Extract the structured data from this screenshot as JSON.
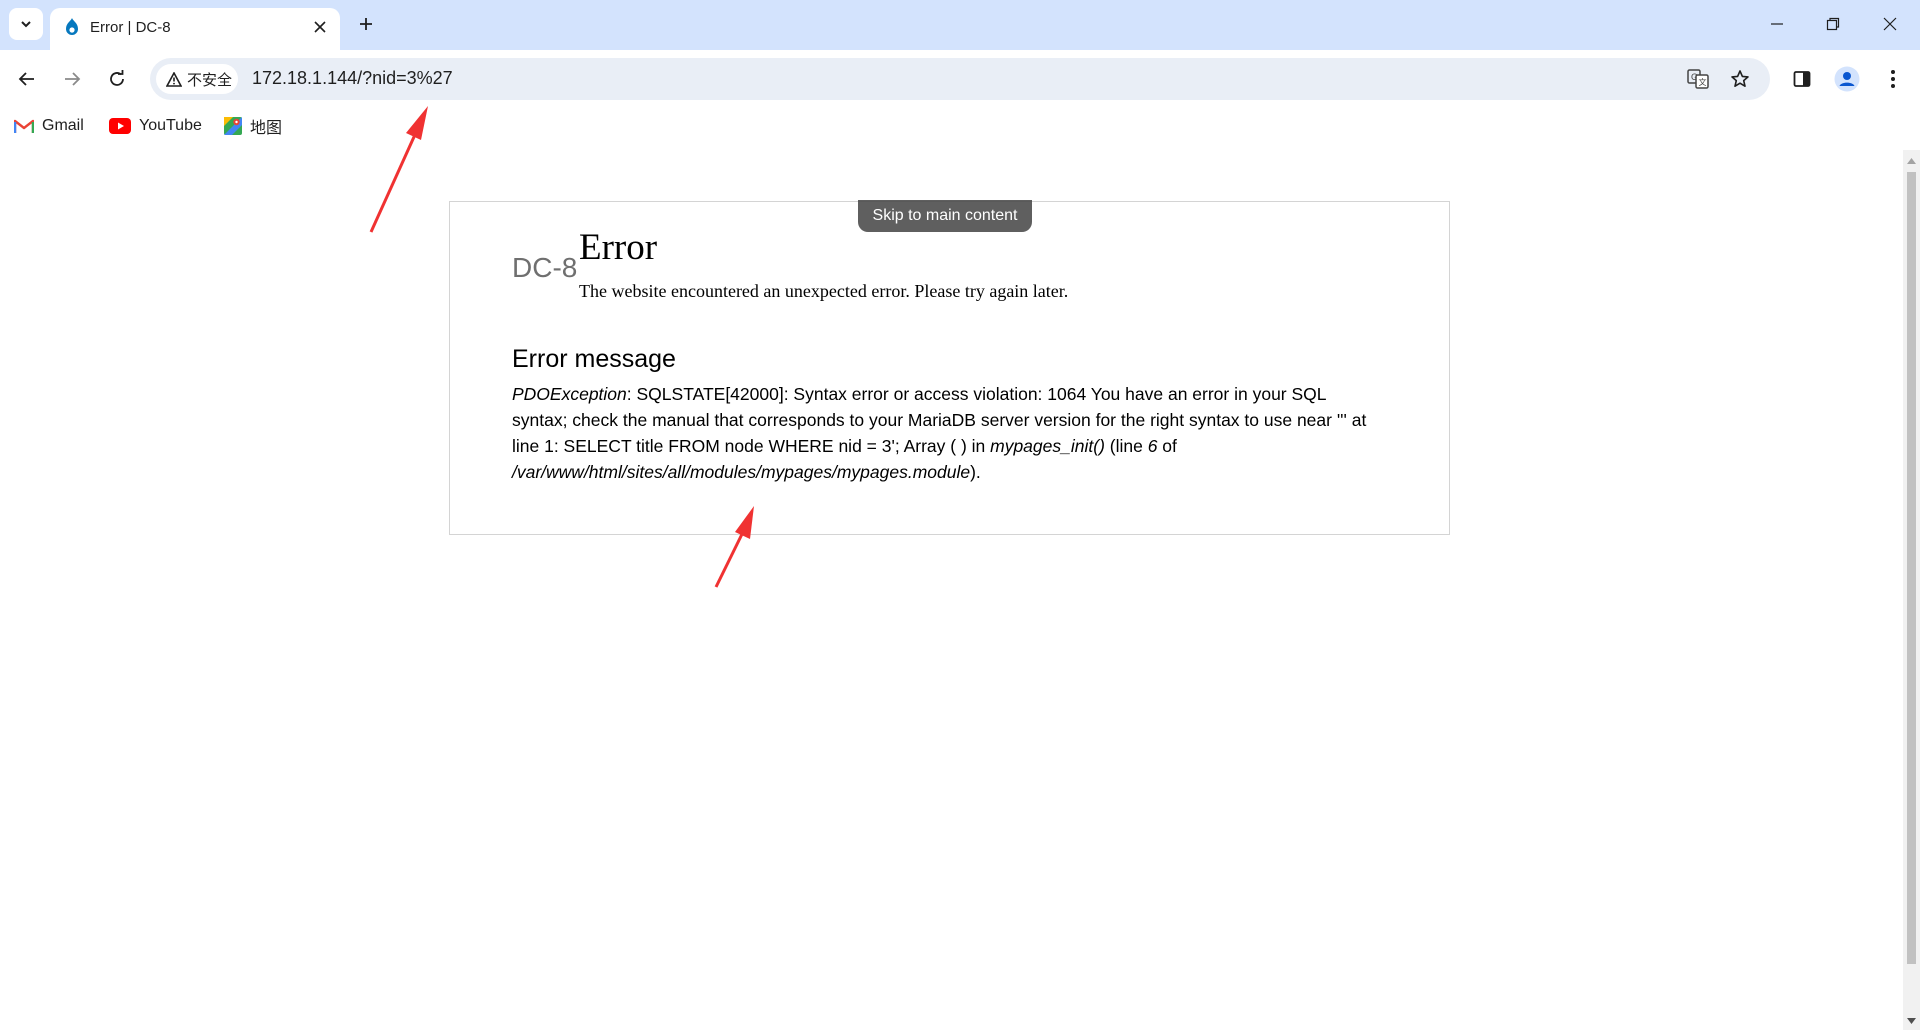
{
  "browser": {
    "tab": {
      "title": "Error | DC-8"
    },
    "address_bar": {
      "security_label": "不安全",
      "url": "172.18.1.144/?nid=3%27"
    },
    "bookmarks": [
      {
        "label": "Gmail",
        "icon": "gmail-icon"
      },
      {
        "label": "YouTube",
        "icon": "youtube-icon"
      },
      {
        "label": "地图",
        "icon": "maps-icon"
      }
    ]
  },
  "page": {
    "skip_link": "Skip to main content",
    "site_name": "DC-8",
    "title": "Error",
    "subtitle": "The website encountered an unexpected error. Please try again later.",
    "error_heading": "Error message",
    "error": {
      "exception": "PDOException",
      "part1": ": SQLSTATE[42000]: Syntax error or access violation: 1064 You have an error in your SQL syntax; check the manual that corresponds to your MariaDB server version for the right syntax to use near ''' at line 1: SELECT title FROM node WHERE nid = 3'; Array ( ) in ",
      "function": "mypages_init()",
      "part2": " (line ",
      "line": "6",
      "part3": " of ",
      "file": "/var/www/html/sites/all/modules/mypages/mypages.module",
      "part4": ")."
    }
  },
  "colors": {
    "chrome_bg": "#d3e3fd",
    "omnibox_bg": "#e9eef6",
    "annotation_arrow": "#f03232",
    "skip_link_bg": "#444444"
  }
}
